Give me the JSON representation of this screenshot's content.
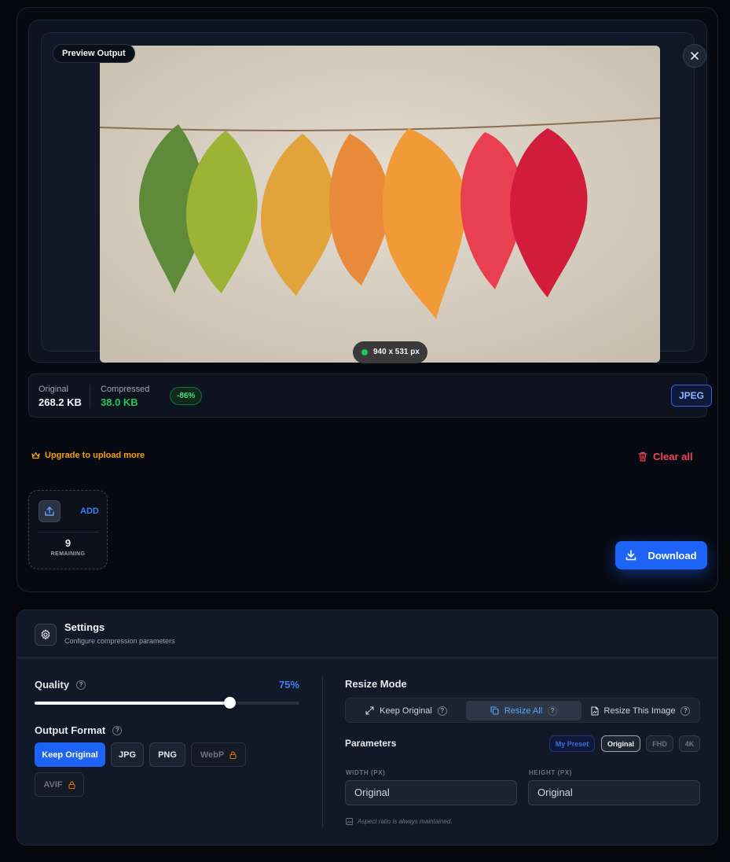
{
  "preview": {
    "badge": "Preview Output",
    "dimensions": "940 x 531 px"
  },
  "stats": {
    "original_label": "Original",
    "original_value": "268.2 KB",
    "compressed_label": "Compressed",
    "compressed_value": "38.0 KB",
    "saving": "-86%",
    "format": "JPEG"
  },
  "actions": {
    "upgrade": "Upgrade to upload more",
    "clear_all": "Clear all",
    "add": "ADD",
    "remaining_count": "9",
    "remaining_label": "REMAINING",
    "download": "Download"
  },
  "settings": {
    "title": "Settings",
    "subtitle": "Configure compression parameters",
    "quality_label": "Quality",
    "quality_value": "75%",
    "quality_fraction": 0.75,
    "output_format_label": "Output Format",
    "formats": [
      {
        "label": "Keep Original",
        "state": "active"
      },
      {
        "label": "JPG",
        "state": "normal"
      },
      {
        "label": "PNG",
        "state": "normal"
      },
      {
        "label": "WebP",
        "state": "locked"
      },
      {
        "label": "AVIF",
        "state": "locked"
      }
    ],
    "resize_mode_label": "Resize Mode",
    "resize_modes": [
      {
        "label": "Keep Original",
        "active": false
      },
      {
        "label": "Resize All",
        "active": true
      },
      {
        "label": "Resize This Image",
        "active": false
      }
    ],
    "parameters_label": "Parameters",
    "presets": [
      {
        "label": "My Preset",
        "kind": "mine"
      },
      {
        "label": "Original",
        "kind": "selected"
      },
      {
        "label": "FHD",
        "kind": "normal"
      },
      {
        "label": "4K",
        "kind": "normal"
      }
    ],
    "width_label": "WIDTH (PX)",
    "width_value": "Original",
    "height_label": "HEIGHT (PX)",
    "height_value": "Original",
    "aspect_note": "Aspect ratio is always maintained."
  },
  "colors": {
    "accent": "#1d63f5",
    "success": "#22c55e",
    "warning": "#f59e0b",
    "danger": "#f04452"
  }
}
